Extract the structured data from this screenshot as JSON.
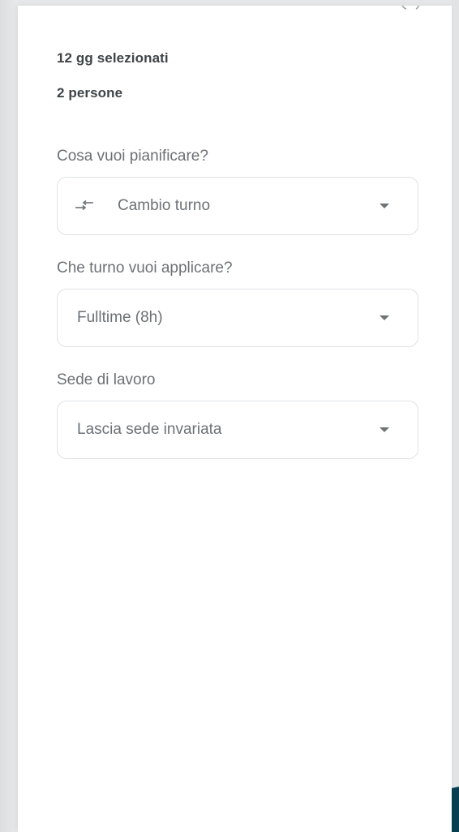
{
  "summary": {
    "days_selected": "12 gg selezionati",
    "people": "2 persone"
  },
  "fields": [
    {
      "label": "Cosa vuoi pianificare?",
      "value": "Cambio turno",
      "icon": "swap-arrows-icon"
    },
    {
      "label": "Che turno vuoi applicare?",
      "value": "Fulltime (8h)"
    },
    {
      "label": "Sede di lavoro",
      "value": "Lascia sede invariata"
    }
  ],
  "colors": {
    "accent_wave": "#073f50",
    "text_muted": "#6c7176",
    "text_strong": "#3f4448",
    "border": "#dfe2e5"
  }
}
